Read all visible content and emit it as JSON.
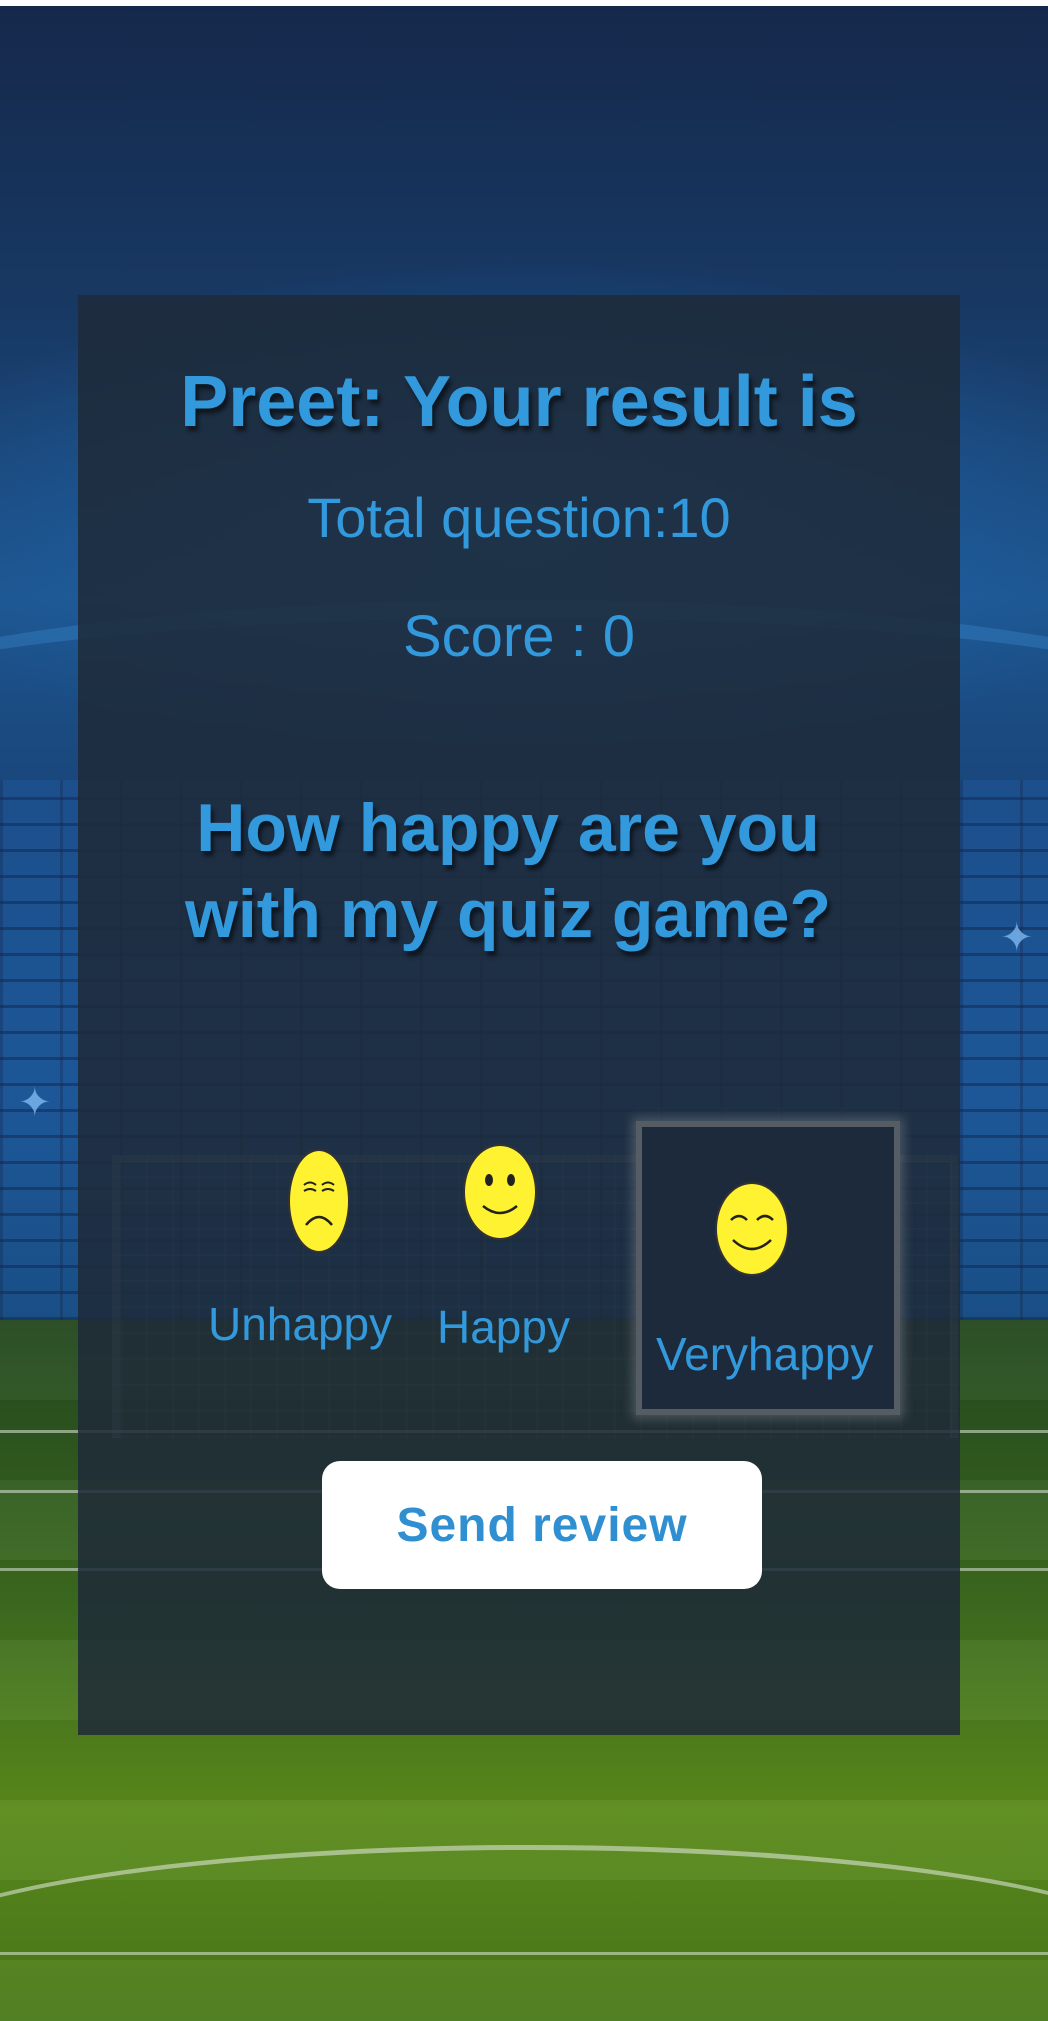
{
  "result": {
    "title": "Preet: Your result is",
    "total_question": "Total question:10",
    "score": "Score : 0"
  },
  "review": {
    "question": "How happy are you with my quiz game?",
    "options": [
      {
        "label": "Unhappy",
        "icon": "sad-face-icon",
        "selected": false
      },
      {
        "label": "Happy",
        "icon": "smile-face-icon",
        "selected": false
      },
      {
        "label": "Veryhappy",
        "icon": "very-happy-face-icon",
        "selected": true
      }
    ],
    "send_label": "Send review"
  },
  "colors": {
    "text_accent": "#3399dd",
    "face_yellow": "#fff230",
    "button_bg": "#ffffff",
    "card_bg": "#1e2a38"
  }
}
